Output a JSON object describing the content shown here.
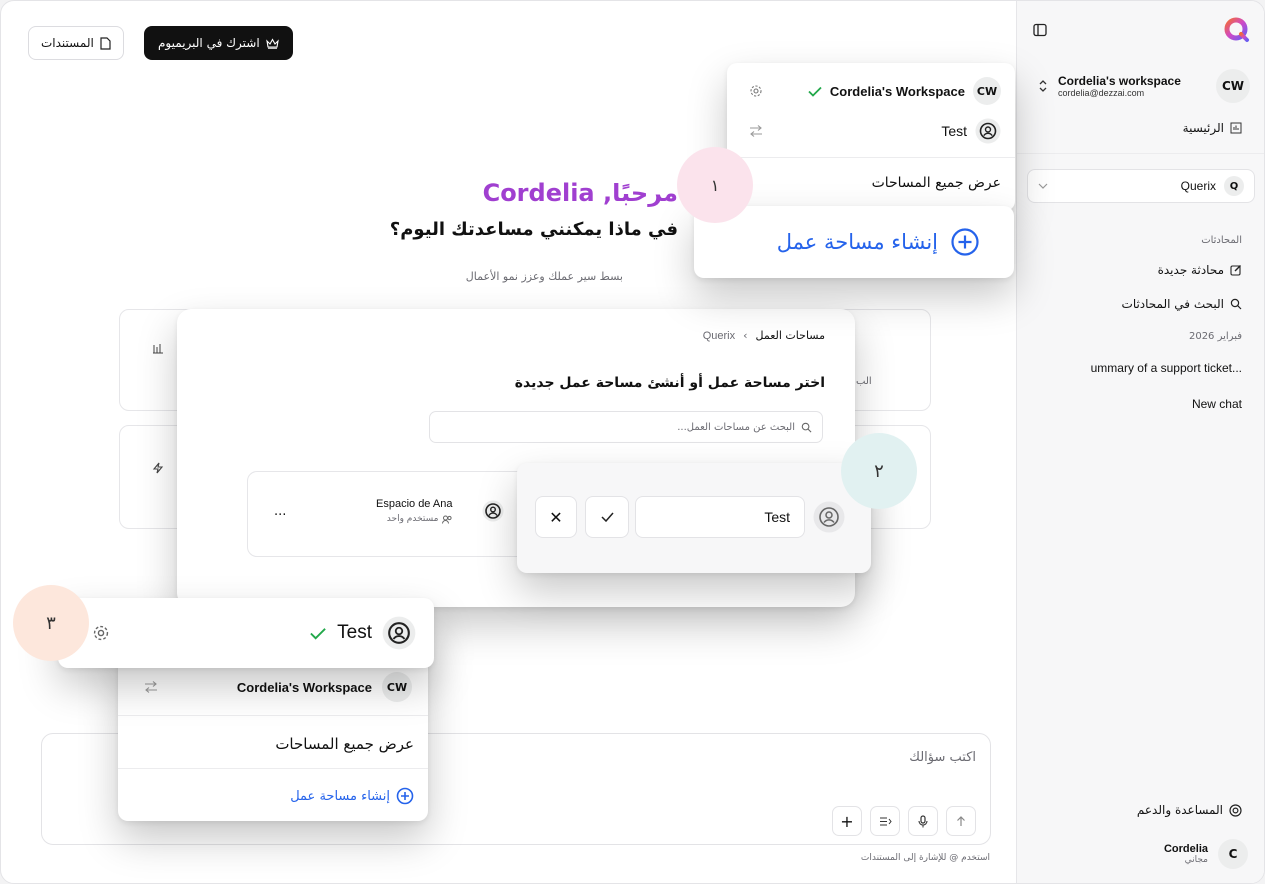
{
  "header": {
    "documents_label": "المستندات",
    "premium_label": "اشترك في البريميوم"
  },
  "sidebar": {
    "workspace_name": "Cordelia's workspace",
    "workspace_email": "cordelia@dezzai.com",
    "workspace_avatar": "CW",
    "home_label": "الرئيسية",
    "agent_name": "Querix",
    "agent_initial": "Q",
    "chats_heading": "المحادثات",
    "new_chat_label": "محادثة جديدة",
    "search_chats_label": "البحث في المحادثات",
    "date_group": "فبراير 2026",
    "chats": [
      "ummary of a support ticket...",
      "New chat"
    ],
    "help_label": "المساعدة والدعم",
    "user_name": "Cordelia",
    "user_plan": "مجاني",
    "user_initial": "C"
  },
  "greeting": {
    "hello": "مرحبًا, Cordelia",
    "question": "في ماذا يمكنني مساعدتك اليوم؟",
    "subtitle": "بسط سير عملك وعزز نمو الأعمال"
  },
  "background_cards": {
    "card1_snippet": "الب"
  },
  "dropdown_top": {
    "workspace_name": "Cordelia's Workspace",
    "workspace_avatar": "CW",
    "test_name": "Test",
    "view_all": "عرض جميع المساحات",
    "create_workspace": "إنشاء مساحة عمل"
  },
  "workspaces_modal": {
    "breadcrumb_root": "Querix",
    "breadcrumb_current": "مساحات العمل",
    "title": "اختر مساحة عمل أو أنشئ مساحة عمل جديدة",
    "search_placeholder": "البحث عن مساحات العمل...",
    "item_name": "Espacio de Ana",
    "item_members": "مستخدم واحد",
    "item_more": "..."
  },
  "rename_popover": {
    "value": "Test"
  },
  "badges": {
    "step1": "١",
    "step2": "٢",
    "step3": "٣"
  },
  "dropdown_bottom": {
    "active_name": "Test",
    "other_workspace": "Cordelia's Workspace",
    "other_avatar": "CW",
    "view_all": "عرض جميع المساحات",
    "create_workspace": "إنشاء مساحة عمل"
  },
  "composer": {
    "placeholder": "اكتب سؤالك",
    "hint": "استخدم @ للإشارة إلى المستندات"
  },
  "colors": {
    "accent_purple": "#a03fd0",
    "link_blue": "#2563eb",
    "check_green": "#22a84a",
    "badge_pink": "#fbe3ec",
    "badge_teal": "#e1f1f1",
    "badge_peach": "#fde7dc"
  }
}
